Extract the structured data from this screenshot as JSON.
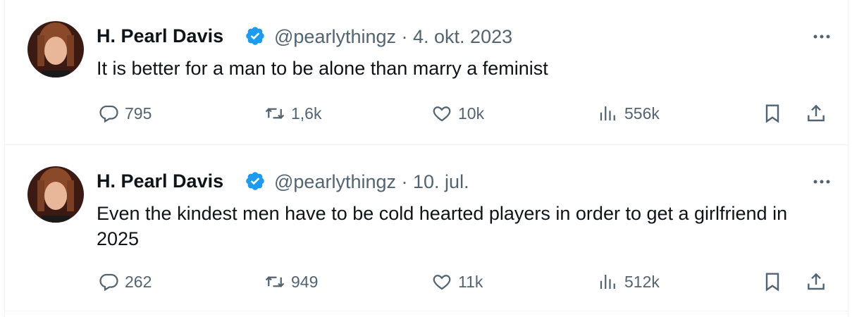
{
  "colors": {
    "text": "#0f1419",
    "secondary": "#536471",
    "verified": "#1d9bf0",
    "border": "#eff3f4"
  },
  "tweets": [
    {
      "author_name": "H. Pearl Davis",
      "handle": "@pearlythingz",
      "separator": "·",
      "date": "4. okt. 2023",
      "text": "It is better for a man to be alone than marry a feminist",
      "replies": "795",
      "retweets": "1,6k",
      "likes": "10k",
      "views": "556k"
    },
    {
      "author_name": "H. Pearl Davis",
      "handle": "@pearlythingz",
      "separator": "·",
      "date": "10. jul.",
      "text": "Even the kindest men have to be cold hearted players in order to get a girlfriend in 2025",
      "replies": "262",
      "retweets": "949",
      "likes": "11k",
      "views": "512k"
    }
  ],
  "icons": [
    "avatar",
    "verified-badge-icon",
    "more-icon",
    "reply-icon",
    "retweet-icon",
    "like-icon",
    "views-icon",
    "bookmark-icon",
    "share-icon"
  ]
}
